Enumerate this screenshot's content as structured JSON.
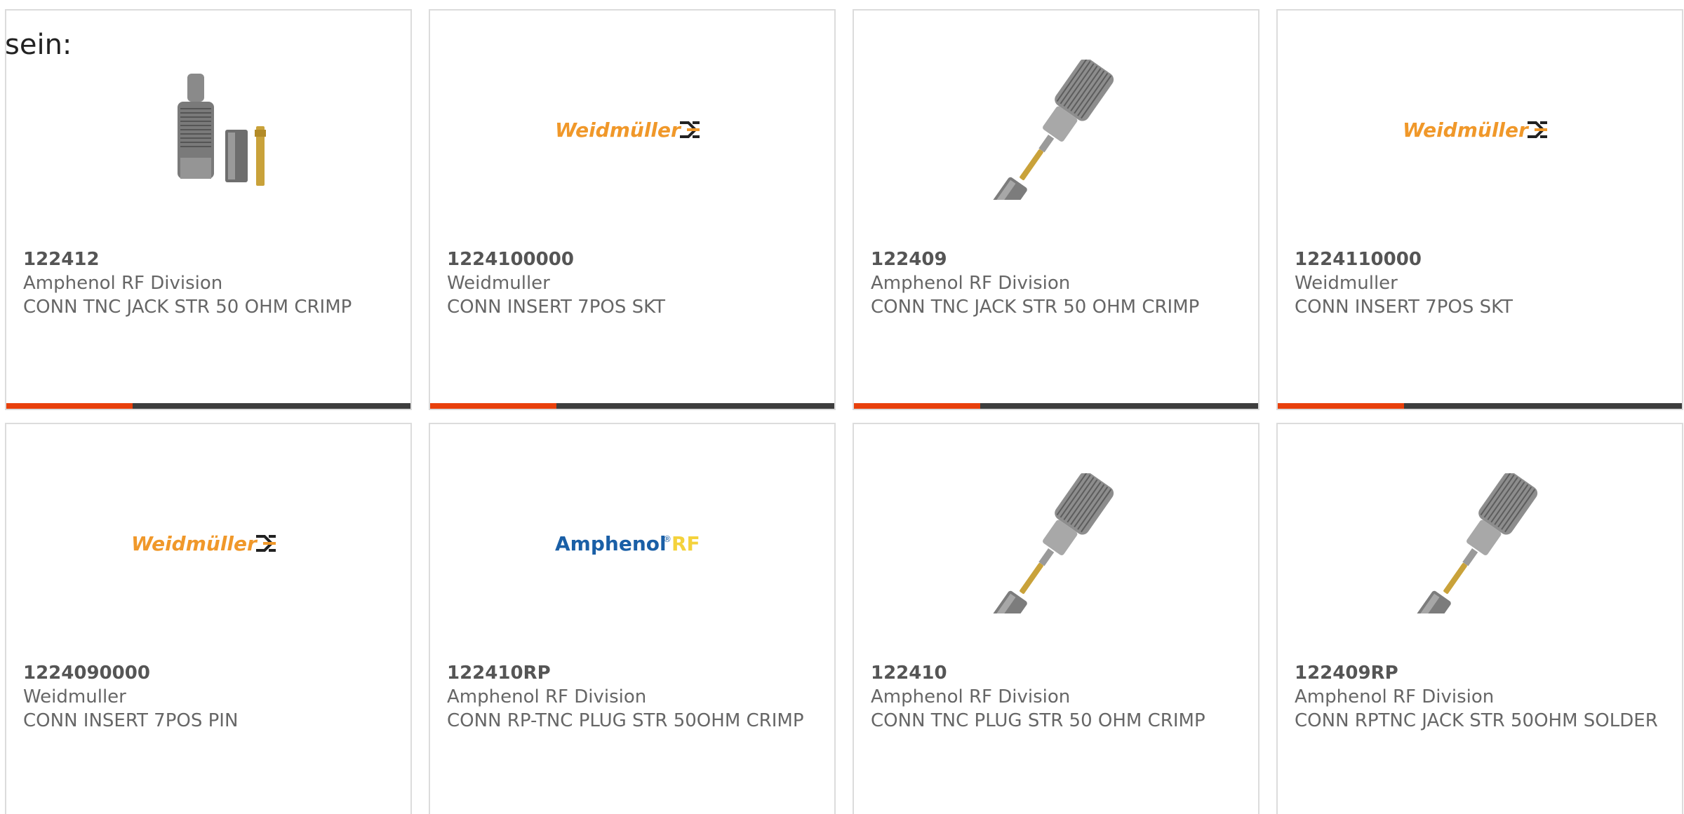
{
  "intro_text": "sein:",
  "colors": {
    "accent": "#e8400c",
    "bar_dark": "#3d3d3d",
    "card_border": "#dcdcdc",
    "text": "#666666",
    "weidmuller_orange": "#f0982a",
    "amphenol_blue": "#1a5fa6",
    "amphenol_rf_yellow": "#f4d23c"
  },
  "products": [
    {
      "part_number": "122412",
      "manufacturer": "Amphenol RF Division",
      "description": "CONN TNC JACK STR 50 OHM CRIMP",
      "image": "tnc-jack-crimp-kit-photo",
      "has_accent_bar": true
    },
    {
      "part_number": "1224100000",
      "manufacturer": "Weidmuller",
      "description": "CONN INSERT 7POS SKT",
      "image": "weidmuller-logo",
      "logo_text": "Weidmüller",
      "has_accent_bar": true
    },
    {
      "part_number": "122409",
      "manufacturer": "Amphenol RF Division",
      "description": "CONN TNC JACK STR 50 OHM CRIMP",
      "image": "tnc-connector-photo",
      "has_accent_bar": true
    },
    {
      "part_number": "1224110000",
      "manufacturer": "Weidmuller",
      "description": "CONN INSERT 7POS SKT",
      "image": "weidmuller-logo",
      "logo_text": "Weidmüller",
      "has_accent_bar": true
    },
    {
      "part_number": "1224090000",
      "manufacturer": "Weidmuller",
      "description": "CONN INSERT 7POS PIN",
      "image": "weidmuller-logo",
      "logo_text": "Weidmüller",
      "has_accent_bar": false
    },
    {
      "part_number": "122410RP",
      "manufacturer": "Amphenol RF Division",
      "description": "CONN RP-TNC PLUG STR 50OHM CRIMP",
      "image": "amphenol-rf-logo",
      "logo_text": "Amphenol",
      "logo_text_2": "RF",
      "has_accent_bar": false
    },
    {
      "part_number": "122410",
      "manufacturer": "Amphenol RF Division",
      "description": "CONN TNC PLUG STR 50 OHM CRIMP",
      "image": "tnc-connector-photo",
      "has_accent_bar": false
    },
    {
      "part_number": "122409RP",
      "manufacturer": "Amphenol RF Division",
      "description": "CONN RPTNC JACK STR 50OHM SOLDER",
      "image": "tnc-connector-photo",
      "has_accent_bar": false
    }
  ]
}
